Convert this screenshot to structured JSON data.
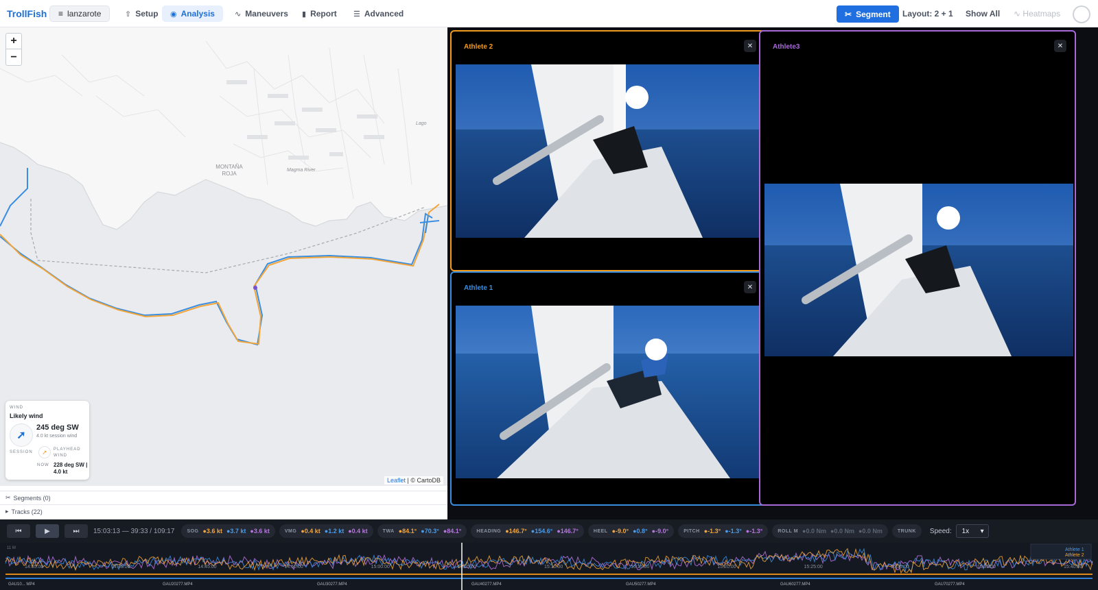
{
  "app": {
    "brand": "TrollFish",
    "project": "lanzarote",
    "nav": [
      {
        "label": "Setup",
        "icon": "upload-icon"
      },
      {
        "label": "Analysis",
        "icon": "eye-icon",
        "active": true
      },
      {
        "label": "Maneuvers",
        "icon": "activity-icon"
      },
      {
        "label": "Report",
        "icon": "bar-chart-icon"
      },
      {
        "label": "Advanced",
        "icon": "sliders-icon"
      }
    ],
    "segment_button": "Segment",
    "layout_label": "Layout: 2 + 1",
    "show_all": "Show All",
    "heatmaps": "Heatmaps"
  },
  "map": {
    "zoom_in": "+",
    "zoom_out": "−",
    "place_labels": [
      "MONTAÑA",
      "ROJA",
      "Magma River",
      "Lago"
    ],
    "attribution_link": "Leaflet",
    "attribution_text": "| © CartoDB",
    "track_colors": {
      "athlete_1": "#3a8ee0",
      "athlete_2": "#f2a53a"
    },
    "wind": {
      "section_label": "WIND",
      "title": "Likely wind",
      "direction": "245 deg SW",
      "session_wind": "4.0 kt session wind",
      "session_label": "SESSION",
      "playhead_label": "PLAYHEAD WIND",
      "now_label": "NOW",
      "now_value": "228 deg SW | 4.0 kt"
    }
  },
  "lists": {
    "segments": "Segments (0)",
    "tracks": "Tracks (22)"
  },
  "videos": [
    {
      "title": "Athlete 2",
      "color": "#f29b1c"
    },
    {
      "title": "Athlete 1",
      "color": "#3a8ee0"
    },
    {
      "title": "Athlete3",
      "color": "#a86ad9"
    }
  ],
  "player": {
    "time": "15:03:13 — 39:33 / 109:17",
    "metrics": [
      {
        "key": "SOG",
        "values": [
          "3.6 kt",
          "3.7 kt",
          "3.6 kt"
        ]
      },
      {
        "key": "VMG",
        "values": [
          "0.4 kt",
          "1.2 kt",
          "0.4 kt"
        ]
      },
      {
        "key": "TWA",
        "values": [
          "84.1°",
          "70.3°",
          "84.1°"
        ]
      },
      {
        "key": "HEADING",
        "values": [
          "146.7°",
          "154.6°",
          "146.7°"
        ]
      },
      {
        "key": "HEEL",
        "values": [
          "-9.0°",
          "0.8°",
          "-9.0°"
        ]
      },
      {
        "key": "PITCH",
        "values": [
          "-1.3°",
          "-1.3°",
          "-1.3°"
        ]
      },
      {
        "key": "ROLL M",
        "values": [
          "0.0 Nm",
          "0.0 Nm",
          "0.0 Nm"
        ]
      },
      {
        "key": "TRUNK",
        "values": []
      }
    ],
    "metric_colors": [
      "#f2a53a",
      "#4a9be8",
      "#b775e0"
    ],
    "speed_label": "Speed:",
    "speed_value": "1x"
  },
  "timeline": {
    "ticks": [
      "14:35:00",
      "14:40:00",
      "14:45:00",
      "14:50:00",
      "15:00:00",
      "15:05:00",
      "15:10:00",
      "15:15:00",
      "15:20:00",
      "15:25:00",
      "15:30:00",
      "15:35:00",
      "15:40:00"
    ],
    "clips": [
      "GAU10... MP4",
      "GAU20277.MP4",
      "GAU30277.MP4",
      "GAU40277.MP4",
      "GAU50277.MP4",
      "GAU60277.MP4",
      "GAU70277.MP4"
    ],
    "legend": [
      "Athlete 1",
      "Athlete 2"
    ],
    "y_label": "11 M"
  }
}
